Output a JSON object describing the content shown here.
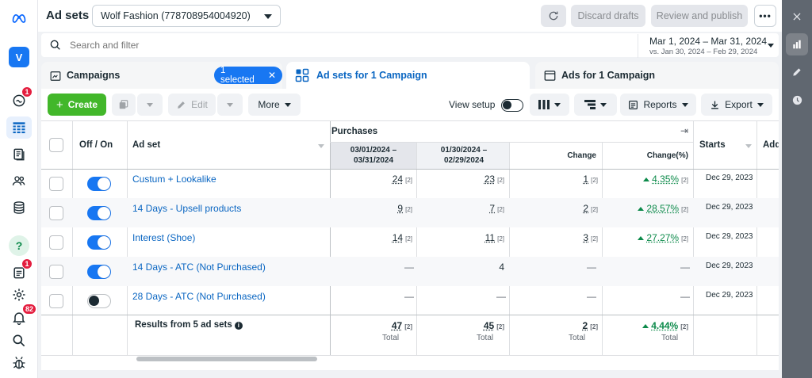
{
  "header": {
    "title": "Ad sets",
    "account": "Wolf Fashion (778708954004920)",
    "discard_label": "Discard drafts",
    "review_label": "Review and publish",
    "more_label": "•••"
  },
  "search": {
    "placeholder": "Search and filter"
  },
  "date_range": {
    "main": "Mar 1, 2024 – Mar 31, 2024",
    "compare": "vs. Jan 30, 2024 – Feb 29, 2024"
  },
  "sidebar": {
    "avatar": "V",
    "badges": {
      "notif1": "1",
      "notif2": "1",
      "alerts": "82"
    },
    "help": "?"
  },
  "tabs": {
    "campaigns": "Campaigns",
    "selected_pill": "1 selected",
    "adsets": "Ad sets for 1 Campaign",
    "ads": "Ads for 1 Campaign"
  },
  "toolbar": {
    "create": "Create",
    "edit": "Edit",
    "more": "More",
    "view_setup": "View setup",
    "reports": "Reports",
    "export": "Export"
  },
  "table": {
    "headers": {
      "offon": "Off / On",
      "adset": "Ad set",
      "purchases": "Purchases",
      "period1": "03/01/2024 – 03/31/2024",
      "period2": "01/30/2024 – 02/29/2024",
      "change": "Change",
      "change_pct": "Change(%)",
      "starts": "Starts",
      "add": "Add"
    },
    "rows": [
      {
        "name": "Custum + Lookalike",
        "on": true,
        "p1": "24",
        "p1s": "[2]",
        "p2": "23",
        "p2s": "[2]",
        "chg": "1",
        "chgs": "[2]",
        "pct": "4.35%",
        "pcts": "[2]",
        "starts": "Dec 29, 2023"
      },
      {
        "name": "14 Days - Upsell products",
        "on": true,
        "p1": "9",
        "p1s": "[2]",
        "p2": "7",
        "p2s": "[2]",
        "chg": "2",
        "chgs": "[2]",
        "pct": "28.57%",
        "pcts": "[2]",
        "starts": "Dec 29, 2023"
      },
      {
        "name": "Interest (Shoe)",
        "on": true,
        "p1": "14",
        "p1s": "[2]",
        "p2": "11",
        "p2s": "[2]",
        "chg": "3",
        "chgs": "[2]",
        "pct": "27.27%",
        "pcts": "[2]",
        "starts": "Dec 29, 2023"
      },
      {
        "name": "14 Days - ATC (Not Purchased)",
        "on": true,
        "p1": "—",
        "p2": "4",
        "chg": "—",
        "pct": "—",
        "starts": "Dec 29, 2023"
      },
      {
        "name": "28 Days - ATC (Not Purchased)",
        "on": false,
        "p1": "—",
        "p2": "—",
        "chg": "—",
        "pct": "—",
        "starts": "Dec 29, 2023"
      }
    ],
    "totals": {
      "label": "Results from 5 ad sets",
      "p1": "47",
      "p1s": "[2]",
      "p2": "45",
      "p2s": "[2]",
      "chg": "2",
      "chgs": "[2]",
      "pct": "4.44%",
      "pcts": "[2]",
      "sub": "Total"
    }
  },
  "colors": {
    "accent": "#1877f2",
    "create": "#42b72a",
    "positive": "#0c8a4a"
  }
}
